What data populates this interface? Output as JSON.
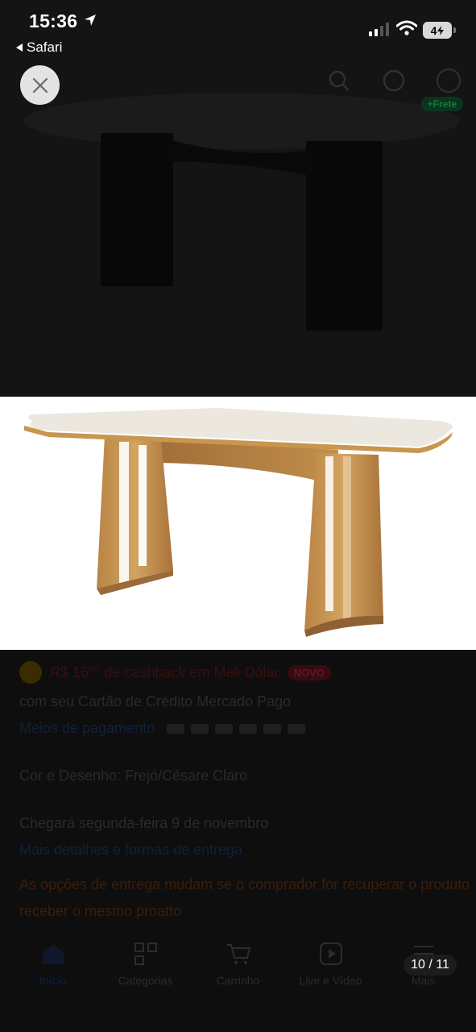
{
  "status_bar": {
    "time": "15:36",
    "back_app": "Safari",
    "battery": "4"
  },
  "viewer": {
    "counter": "10 / 11",
    "close_icon": "close-icon",
    "image_subject": "table-icon"
  },
  "background_page": {
    "cashback_text": "R$ 16⁰⁰ de cashback em Meli Dólar",
    "cashback_badge": "NOVO",
    "credit_text": "com seu Cartão de Crédito Mercado Pago",
    "payment_link": "Meios de pagamento",
    "color_label": "Cor e Desenho: Frejó/Césare Claro",
    "delivery_text": "Chegará segunda-feira 9 de novembro",
    "delivery_link": "Mais detalhes e formas de entrega",
    "notice_text": "As opções de entrega mudam se o comprador for recuperar o produto",
    "notice_text_2": "receber o mesmo proatto",
    "cart_badge": "+Frete",
    "tabs": [
      {
        "label": "Início",
        "icon": "home-icon",
        "active": true
      },
      {
        "label": "Categorias",
        "icon": "categories-icon",
        "active": false
      },
      {
        "label": "Carrinho",
        "icon": "cart-icon",
        "active": false
      },
      {
        "label": "Live e Vídeo",
        "icon": "video-icon",
        "active": false
      },
      {
        "label": "Mais",
        "icon": "menu-icon",
        "active": false
      }
    ]
  },
  "colors": {
    "viewer_bg": "#000000",
    "close_button": "#e3e3e3",
    "table_top": "#ece8df",
    "table_wood": "#c8964e"
  }
}
